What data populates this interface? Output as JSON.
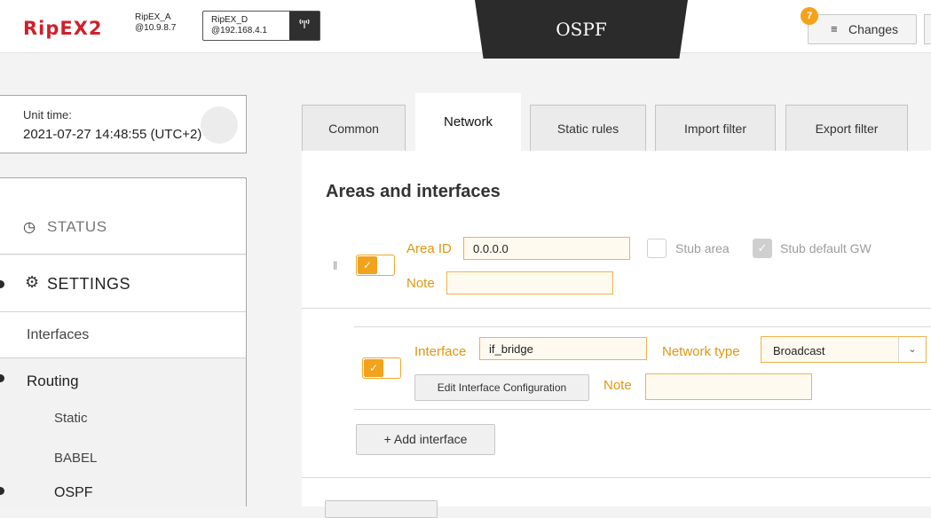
{
  "header": {
    "logo": "RipEX2",
    "unit_a": {
      "name": "RipEX_A",
      "ip": "@10.9.8.7"
    },
    "unit_d": {
      "name": "RipEX_D",
      "ip": "@192.168.4.1"
    },
    "signal_icon": "signal-icon",
    "page_title": "OSPF",
    "changes_label": "Changes",
    "changes_count": "7"
  },
  "unit_time": {
    "label": "Unit time:",
    "value": "2021-07-27 14:48:55 (UTC+2)"
  },
  "sidebar": {
    "status": "STATUS",
    "settings": "SETTINGS",
    "interfaces": "Interfaces",
    "routing": "Routing",
    "routing_items": [
      "Static",
      "BABEL"
    ],
    "ospf": "OSPF"
  },
  "tabs": [
    "Common",
    "Network",
    "Static rules",
    "Import filter",
    "Export filter"
  ],
  "active_tab": "Network",
  "areas": {
    "heading": "Areas and interfaces",
    "area_id_label": "Area ID",
    "area_id_value": "0.0.0.0",
    "stub_area_label": "Stub area",
    "stub_default_gw_label": "Stub default GW",
    "note_label": "Note",
    "note_value": ""
  },
  "interface": {
    "interface_label": "Interface",
    "interface_value": "if_bridge",
    "network_type_label": "Network type",
    "network_type_value": "Broadcast",
    "edit_button": "Edit Interface Configuration",
    "note_label": "Note",
    "note_value": ""
  },
  "add_interface_button": "Add interface",
  "colors": {
    "accent": "#f2a21c",
    "brand": "#d0202a",
    "dark": "#2b2b2b"
  }
}
